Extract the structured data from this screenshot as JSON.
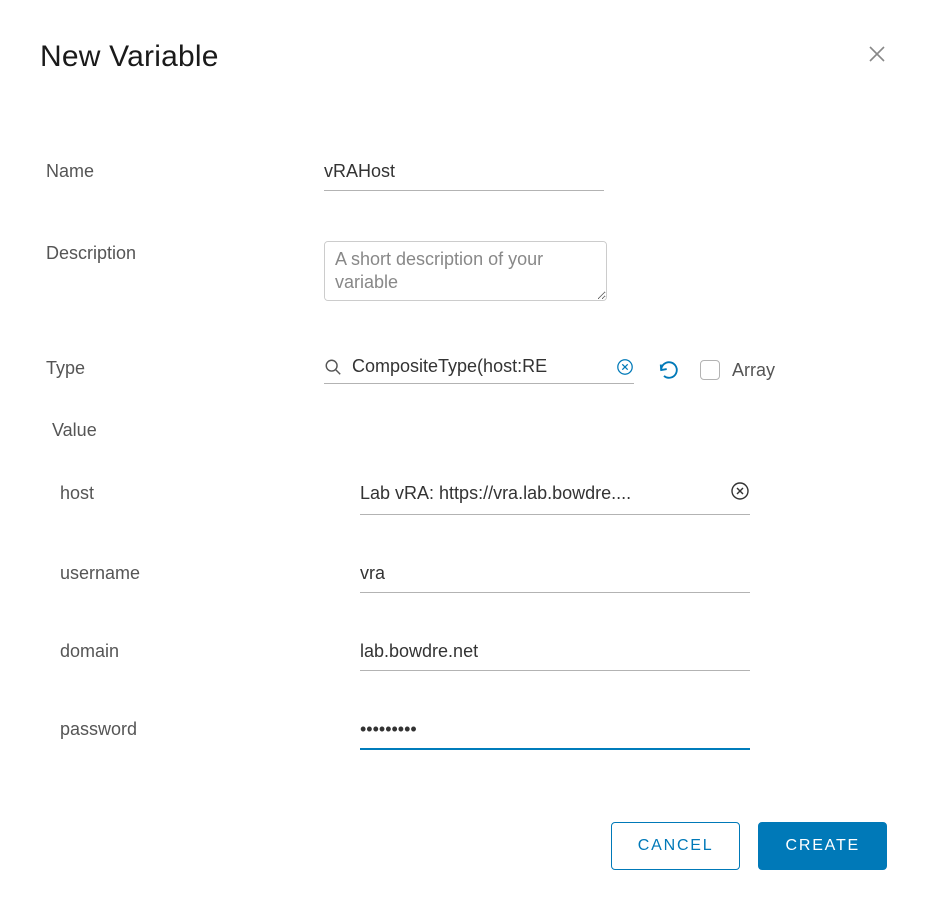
{
  "dialog": {
    "title": "New Variable"
  },
  "form": {
    "name": {
      "label": "Name",
      "value": "vRAHost"
    },
    "description": {
      "label": "Description",
      "placeholder": "A short description of your variable",
      "value": ""
    },
    "type": {
      "label": "Type",
      "value": "CompositeType(host:RE",
      "array_label": "Array",
      "array_checked": false
    },
    "value_section": {
      "label": "Value"
    },
    "value": {
      "host": {
        "label": "host",
        "value": "Lab vRA: https://vra.lab.bowdre...."
      },
      "username": {
        "label": "username",
        "value": "vra"
      },
      "domain": {
        "label": "domain",
        "value": "lab.bowdre.net"
      },
      "password": {
        "label": "password",
        "value": "•••••••••"
      }
    }
  },
  "buttons": {
    "cancel": "CANCEL",
    "create": "CREATE"
  }
}
